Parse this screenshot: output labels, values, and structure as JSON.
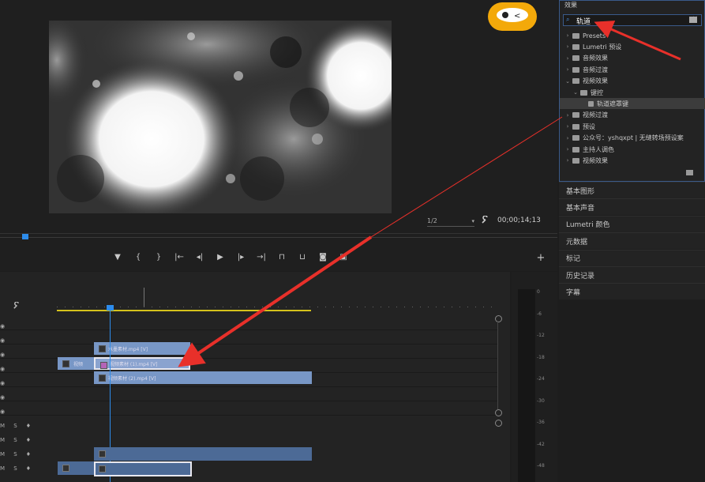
{
  "monitor": {
    "zoom_select": "1/2",
    "timecode": "00;00;14;13"
  },
  "watermark": "课堂",
  "effects": {
    "title": "效果",
    "search_value": "轨道",
    "tree": [
      {
        "label": "Presets",
        "expanded": false,
        "depth": 0
      },
      {
        "label": "Lumetri 预设",
        "expanded": false,
        "depth": 0
      },
      {
        "label": "音频效果",
        "expanded": false,
        "depth": 0
      },
      {
        "label": "音频过渡",
        "expanded": false,
        "depth": 0
      },
      {
        "label": "视频效果",
        "expanded": true,
        "depth": 0
      },
      {
        "label": "键控",
        "expanded": true,
        "depth": 1
      },
      {
        "label": "轨道遮罩键",
        "expanded": false,
        "depth": 2,
        "selected": true
      },
      {
        "label": "视频过渡",
        "expanded": false,
        "depth": 0
      },
      {
        "label": "预设",
        "expanded": false,
        "depth": 0
      },
      {
        "label": "公众号：yshqxpt | 无缝转场预设案",
        "expanded": false,
        "depth": 0
      },
      {
        "label": "主持人调色",
        "expanded": false,
        "depth": 0
      },
      {
        "label": "视频效果",
        "expanded": false,
        "depth": 0
      }
    ]
  },
  "panels": [
    "基本图形",
    "基本声音",
    "Lumetri 颜色",
    "元数据",
    "标记",
    "历史记录",
    "字幕"
  ],
  "timeline": {
    "clips": {
      "v3": "水墨素材.mp4 [V]",
      "v2_label": "视频",
      "v2": "视频素材 (1).mp4 [V]",
      "v1": "视频素材 (2).mp4 [V]"
    },
    "audio_labels": {
      "m": "M",
      "s": "S"
    }
  },
  "meter": {
    "scale": [
      "0",
      "-6",
      "-12",
      "-18",
      "-24",
      "-30",
      "-36",
      "-42",
      "-48"
    ]
  },
  "colors": {
    "clip_blue": "#7897c6",
    "clip_blue_dark": "#4c6a96",
    "annotation_red": "#e8302a",
    "work_area_yellow": "#d4c21c",
    "playhead_blue": "#2d8ceb"
  }
}
